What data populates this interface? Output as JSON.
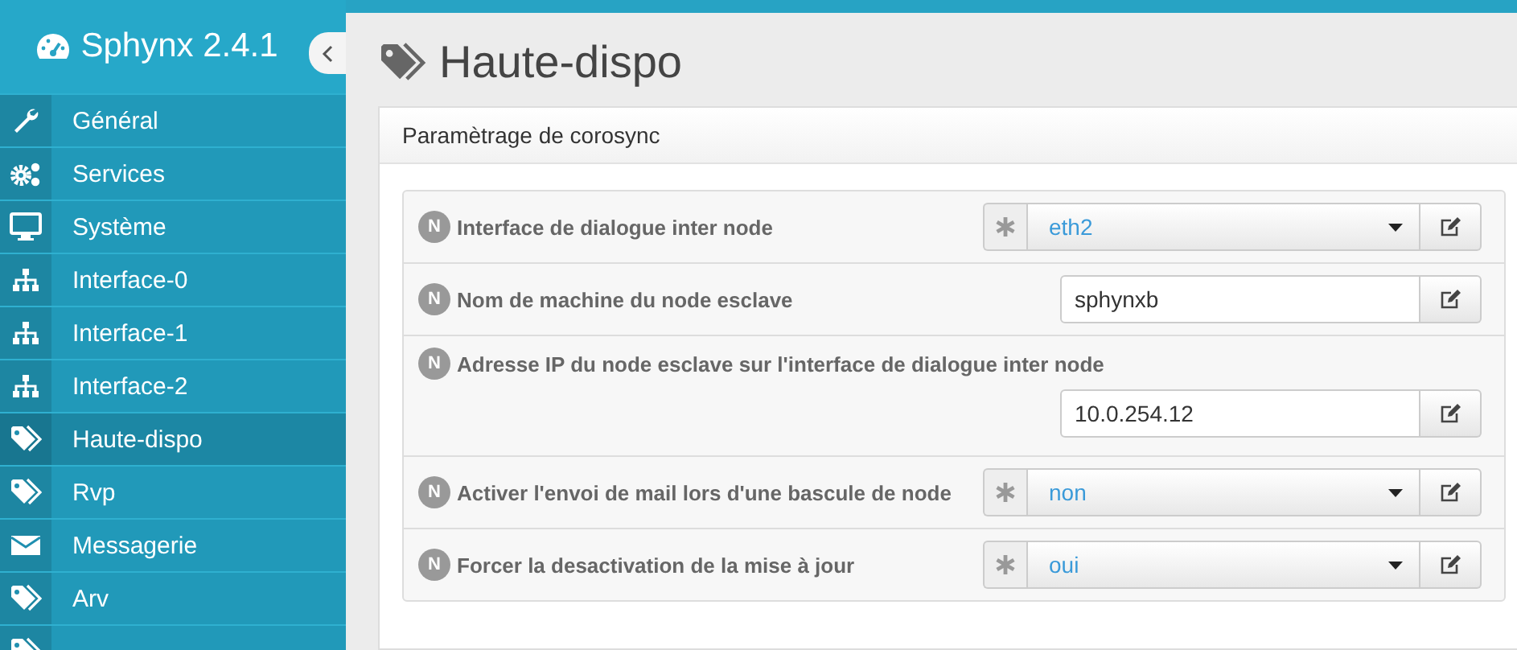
{
  "brand": {
    "title": "Sphynx 2.4.1"
  },
  "sidebar": {
    "items": [
      {
        "label": "Général",
        "kind": "settings",
        "selected": false
      },
      {
        "label": "Services",
        "kind": "services",
        "selected": false
      },
      {
        "label": "Système",
        "kind": "system",
        "selected": false
      },
      {
        "label": "Interface-0",
        "kind": "network",
        "selected": false
      },
      {
        "label": "Interface-1",
        "kind": "network",
        "selected": false
      },
      {
        "label": "Interface-2",
        "kind": "network",
        "selected": false
      },
      {
        "label": "Haute-dispo",
        "kind": "tag",
        "selected": true
      },
      {
        "label": "Rvp",
        "kind": "tag",
        "selected": false
      },
      {
        "label": "Messagerie",
        "kind": "mail",
        "selected": false
      },
      {
        "label": "Arv",
        "kind": "tag",
        "selected": false
      },
      {
        "kind": "tag",
        "selected": false
      }
    ]
  },
  "page": {
    "title": "Haute-dispo"
  },
  "panel": {
    "title": "Paramètrage de corosync",
    "fields": [
      {
        "badge": "N",
        "label": "Interface de dialogue inter node",
        "kind": "select",
        "value": "eth2"
      },
      {
        "badge": "N",
        "label": "Nom de machine du node esclave",
        "kind": "text",
        "value": "sphynxb"
      },
      {
        "badge": "N",
        "label": "Adresse IP du node esclave sur l'interface de dialogue inter node",
        "kind": "text-below",
        "value": "10.0.254.12"
      },
      {
        "badge": "N",
        "label": "Activer l'envoi de mail lors d'une bascule de node",
        "kind": "select",
        "value": "non"
      },
      {
        "badge": "N",
        "label": "Forcer la desactivation de la mise à jour",
        "kind": "select",
        "value": "oui"
      }
    ]
  }
}
